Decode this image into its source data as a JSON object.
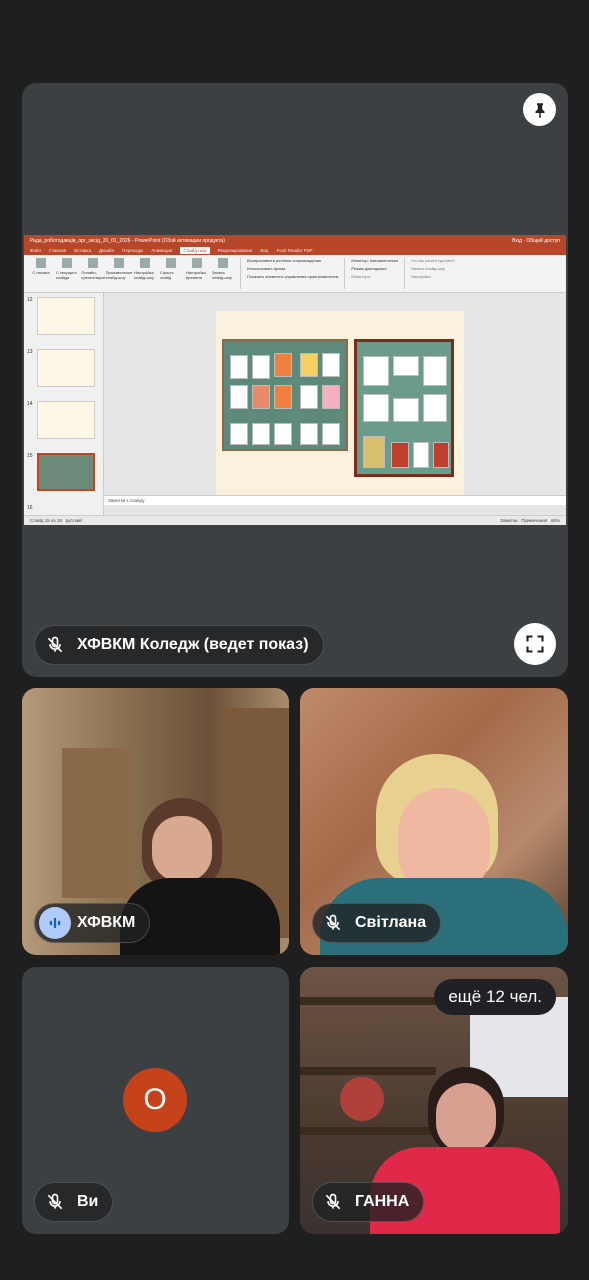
{
  "presenter": {
    "name": "ХФВКМ Коледж (ведет показ)",
    "pin_icon": "pin-icon",
    "fullscreen_icon": "fullscreen-icon",
    "mic_icon": "mic-off-icon"
  },
  "screen": {
    "title": "Рада_роботодавців_орг_засід_20_01_2026 - PowerPoint (Сбой активации продукта)",
    "user": "Вхід",
    "share": "Общий доступ",
    "tabs": [
      "Файл",
      "Главная",
      "Вставка",
      "Дизайн",
      "Переходы",
      "Анимация",
      "Слайд-шоу",
      "Рецензирование",
      "Вид",
      "Foxit Reader PDF"
    ],
    "active_tab": "Слайд-шоу",
    "search_hint": "Что вы хотите сделать?",
    "ribbon_buttons": [
      "С начала",
      "С текущего слайда",
      "Онлайн-презентация",
      "Произвольное слайд-шоу",
      "Настройка слайд-шоу",
      "Скрыть слайд",
      "Настройка времени",
      "Запись слайд-шоу"
    ],
    "checkboxes": [
      "Воспроизвести речевое сопровождение",
      "Использовать время",
      "Показать элементы управления проигрывателем"
    ],
    "monitor_label": "Монитор:",
    "monitor_value": "Автоматически",
    "presenter_mode": "Режим докладчика",
    "group_start": "Начать слайд-шоу",
    "group_setup": "Настройка",
    "group_monitors": "Мониторы",
    "thumb_numbers": [
      "12",
      "13",
      "14",
      "15",
      "16"
    ],
    "notes_placeholder": "Заметки к слайду",
    "status_left": "Слайд 15 из 18",
    "status_lang": "русский",
    "status_notes": "Заметки",
    "status_comments": "Примечания",
    "zoom": "66%"
  },
  "participants": [
    {
      "name": "ХФВКМ",
      "mic": "speaking-icon"
    },
    {
      "name": "Світлана",
      "mic": "mic-off-icon"
    },
    {
      "name": "Ви",
      "mic": "mic-off-icon",
      "initial": "О"
    },
    {
      "name": "ГАННА",
      "mic": "mic-off-icon"
    }
  ],
  "more_participants": "ещё 12 чел.",
  "colors": {
    "background": "#1f1f1f",
    "tile": "#3c4043",
    "avatar": "#c5421b",
    "speaking": "#aecbfa",
    "ppt_accent": "#b7472a"
  }
}
